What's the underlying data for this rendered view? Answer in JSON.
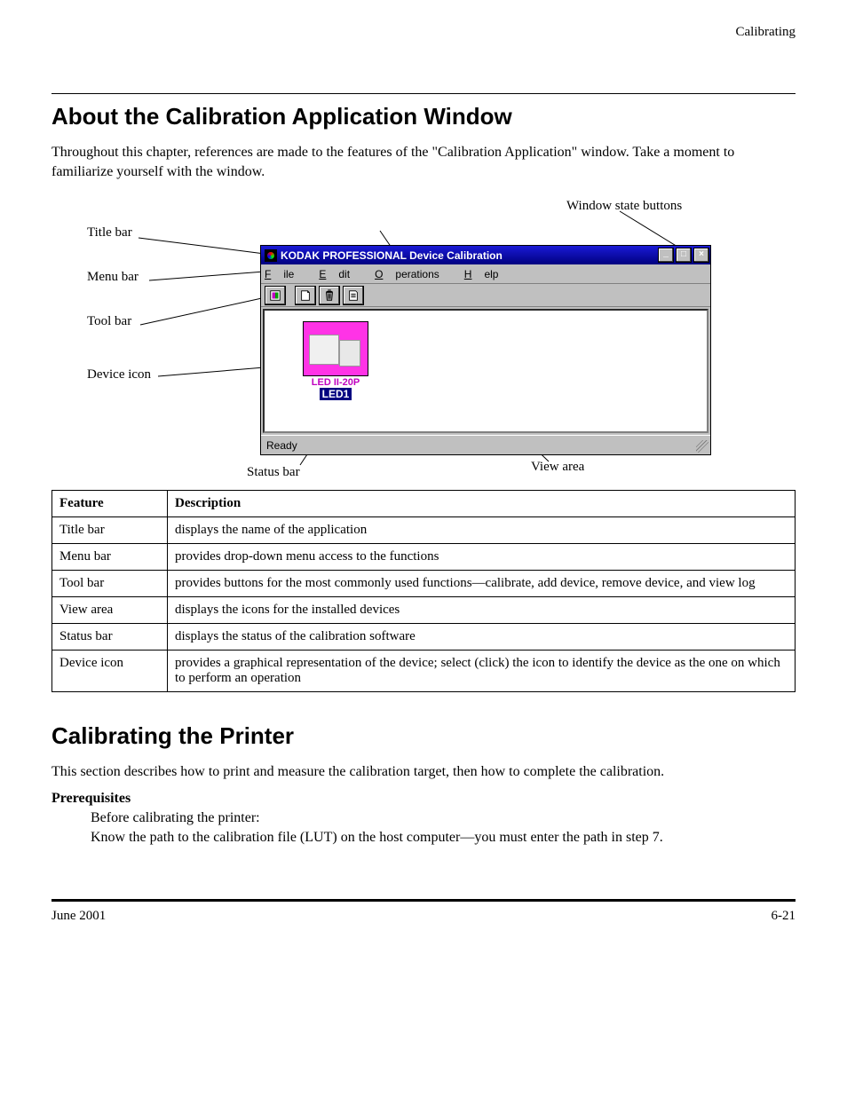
{
  "header_right": "Calibrating",
  "section_title": "About the Calibration Application Window",
  "lead": "Throughout this chapter, references are made to the features of the \"Calibration Application\" window. Take a moment to familiarize yourself with the window.",
  "callouts": {
    "menu_bar": "Menu bar",
    "tool_bar": "Tool bar",
    "title_bar": "Title bar",
    "window_state": "Window state buttons",
    "device_icon": "Device icon",
    "status_bar": "Status bar",
    "view_area": "View area"
  },
  "window": {
    "title": "KODAK PROFESSIONAL Device Calibration",
    "menus": {
      "file": "File",
      "edit": "Edit",
      "operations": "Operations",
      "help": "Help"
    },
    "device_cap": "LED II-20P",
    "device_label": "LED1",
    "status": "Ready"
  },
  "table": {
    "h1": "Feature",
    "h2": "Description",
    "rows": [
      {
        "label": "Title bar",
        "desc": "displays the name of the application"
      },
      {
        "label": "Menu bar",
        "desc": "provides drop-down menu access to the functions"
      },
      {
        "label": "Tool bar",
        "desc": "provides buttons for the most commonly used functions—calibrate, add device, remove device, and view log"
      },
      {
        "label": "View area",
        "desc": "displays the icons for the installed devices"
      },
      {
        "label": "Status bar",
        "desc": "displays the status of the calibration software"
      },
      {
        "label": "Device icon",
        "desc": "provides a graphical representation of the device; select (click) the icon to identify the device as the one on which to perform an operation"
      }
    ]
  },
  "sub_title": "Calibrating the Printer",
  "sub_lead": "This section describes how to print and measure the calibration target, then how to complete the calibration.",
  "prereq": {
    "heading": "Prerequisites",
    "line1": "Before calibrating the printer:",
    "line2": "Know the path to the calibration file (LUT) on the host computer—you must enter the path in step 7."
  },
  "footer": {
    "left": "June 2001",
    "right": "6-21"
  }
}
